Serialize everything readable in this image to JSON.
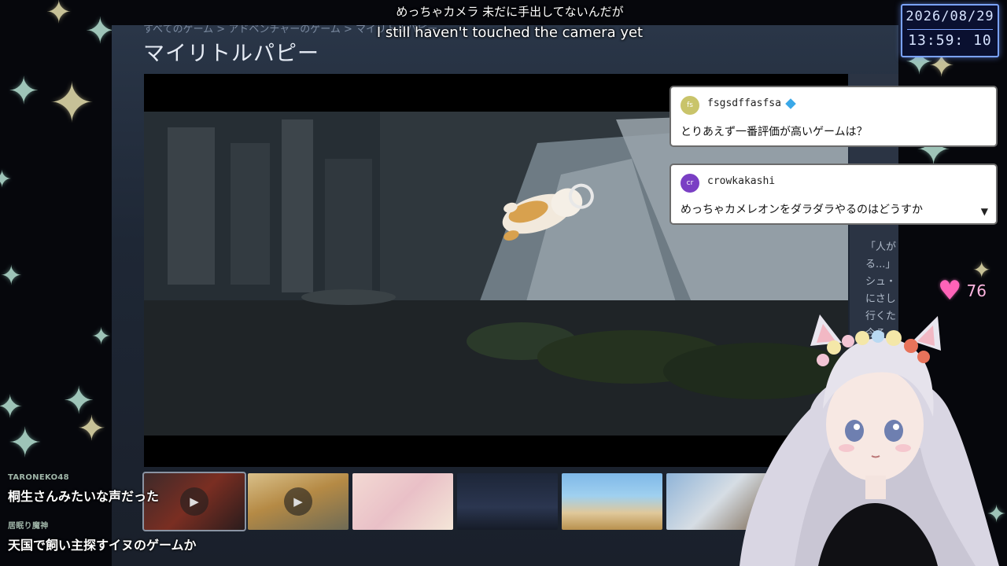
{
  "subtitles": {
    "japanese": "めっちゃカメラ 未だに手出してないんだが",
    "english": "I still haven't touched the camera yet"
  },
  "clock": {
    "date": "2026/08/29",
    "time": "13:59: 10"
  },
  "store": {
    "breadcrumb": "すべてのゲーム > アドベンチャーのゲーム > マイリトルパピー",
    "title": "マイリトルパピー",
    "description": "「人が\nる...」\nシュ・\nにさし\n行くた\n今ろ"
  },
  "chat": [
    {
      "initials": "fs",
      "avatar_color": "#c9c46a",
      "user": "fsgsdffasfsa",
      "message": "とりあえず一番評価が高いゲームは？",
      "badge": "diamond-icon"
    },
    {
      "initials": "cr",
      "avatar_color": "#7a3fc4",
      "user": "crowkakashi",
      "message": "めっちゃカメレオンをダラダラやるのはどうすか",
      "expand_icon": "▼"
    }
  ],
  "likes": {
    "icon": "heart-icon",
    "count": "76"
  },
  "bottom_comments": [
    {
      "user": "TARONEKO48",
      "text": "桐生さんみたいな声だった"
    },
    {
      "user": "居眠り魔神",
      "text": "天国で飼い主探すイヌのゲームか"
    }
  ],
  "play_icon": "▶"
}
